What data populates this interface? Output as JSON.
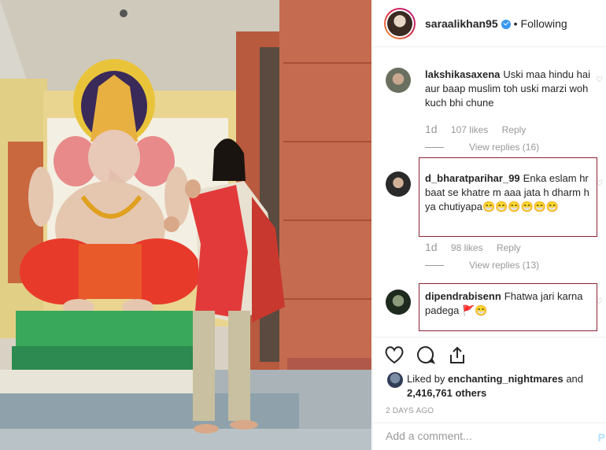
{
  "header": {
    "username": "saraalikhan95",
    "separator": "•",
    "follow_status": "Following"
  },
  "comments": [
    {
      "username": "lakshikasaxena",
      "text": "Uski maa hindu hai aur baap muslim toh uski marzi woh kuch bhi chune",
      "ago": "1d",
      "likes": "107 likes",
      "reply_label": "Reply",
      "view_replies": "View replies (16)"
    },
    {
      "username": "d_bharatparihar_99",
      "text": "Enka eslam hr baat se khatre m aaa jata h dharm h ya chutiyapa😁😁😁😁😁😁",
      "ago": "1d",
      "likes": "98 likes",
      "reply_label": "Reply",
      "view_replies": "View replies (13)"
    },
    {
      "username": "dipendrabisenn",
      "text": "Fhatwa jari karna padega 🚩😁"
    }
  ],
  "likes": {
    "prefix": "Liked by",
    "user": "enchanting_nightmares",
    "joiner": "and",
    "count": "2,416,761 others"
  },
  "time_ago": "2 DAYS AGO",
  "add_comment": {
    "placeholder": "Add a comment...",
    "post_label": "P"
  },
  "icons": {
    "verified": "verified-badge-icon",
    "like": "heart-icon",
    "comment": "comment-bubble-icon",
    "share": "share-icon",
    "comment_like": "small-heart-icon"
  },
  "colors": {
    "highlight_box": "#8b2232",
    "verified_blue": "#3897f0",
    "muted_text": "#999999"
  }
}
